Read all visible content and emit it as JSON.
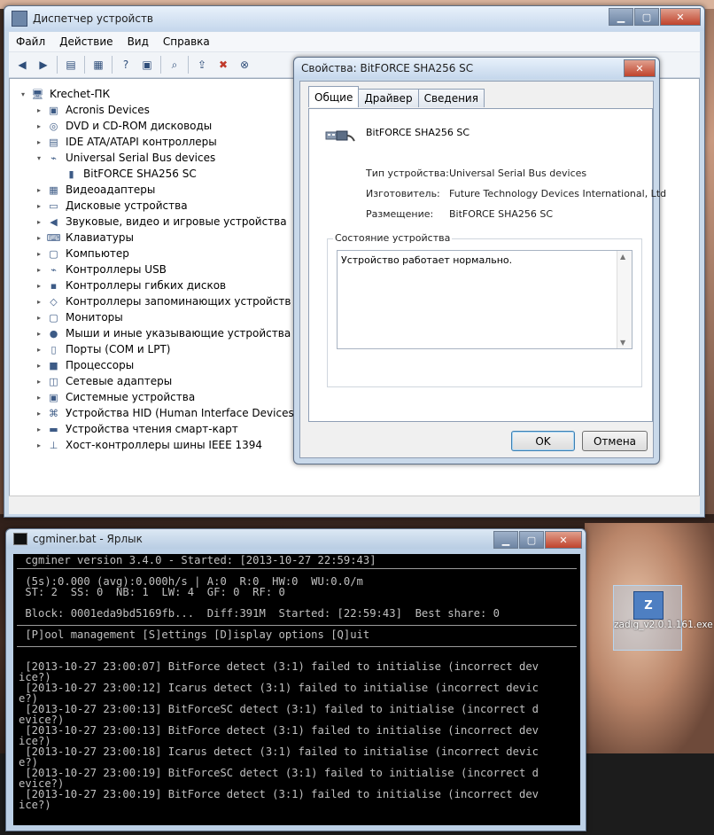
{
  "device_manager": {
    "title": "Диспетчер устройств",
    "menu": [
      "Файл",
      "Действие",
      "Вид",
      "Справка"
    ],
    "toolbar_icons": [
      "back-icon",
      "forward-icon",
      "up-icon",
      "properties-icon",
      "help-icon",
      "view-icon",
      "scan-icon",
      "update-driver-icon",
      "disable-icon",
      "uninstall-icon"
    ],
    "tree": [
      {
        "label": "Krechet-ПК",
        "level": 0,
        "expander": "▾",
        "icon": "computer-icon"
      },
      {
        "label": "Acronis Devices",
        "level": 1,
        "expander": "▸",
        "icon": "device-icon"
      },
      {
        "label": "DVD и CD-ROM дисководы",
        "level": 1,
        "expander": "▸",
        "icon": "dvd-icon"
      },
      {
        "label": "IDE ATA/ATAPI контроллеры",
        "level": 1,
        "expander": "▸",
        "icon": "ide-icon"
      },
      {
        "label": "Universal Serial Bus devices",
        "level": 1,
        "expander": "▾",
        "icon": "usb-icon"
      },
      {
        "label": "BitFORCE SHA256 SC",
        "level": 2,
        "expander": "",
        "icon": "usb-plug-icon"
      },
      {
        "label": "Видеоадаптеры",
        "level": 1,
        "expander": "▸",
        "icon": "display-adapter-icon"
      },
      {
        "label": "Дисковые устройства",
        "level": 1,
        "expander": "▸",
        "icon": "disk-icon"
      },
      {
        "label": "Звуковые, видео и игровые устройства",
        "level": 1,
        "expander": "▸",
        "icon": "speaker-icon"
      },
      {
        "label": "Клавиатуры",
        "level": 1,
        "expander": "▸",
        "icon": "keyboard-icon"
      },
      {
        "label": "Компьютер",
        "level": 1,
        "expander": "▸",
        "icon": "monitor-icon"
      },
      {
        "label": "Контроллеры USB",
        "level": 1,
        "expander": "▸",
        "icon": "usb-controller-icon"
      },
      {
        "label": "Контроллеры гибких дисков",
        "level": 1,
        "expander": "▸",
        "icon": "floppy-icon"
      },
      {
        "label": "Контроллеры запоминающих устройств",
        "level": 1,
        "expander": "▸",
        "icon": "storage-icon"
      },
      {
        "label": "Мониторы",
        "level": 1,
        "expander": "▸",
        "icon": "monitor-icon"
      },
      {
        "label": "Мыши и иные указывающие устройства",
        "level": 1,
        "expander": "▸",
        "icon": "mouse-icon"
      },
      {
        "label": "Порты (COM и LPT)",
        "level": 1,
        "expander": "▸",
        "icon": "port-icon"
      },
      {
        "label": "Процессоры",
        "level": 1,
        "expander": "▸",
        "icon": "cpu-icon"
      },
      {
        "label": "Сетевые адаптеры",
        "level": 1,
        "expander": "▸",
        "icon": "network-icon"
      },
      {
        "label": "Системные устройства",
        "level": 1,
        "expander": "▸",
        "icon": "system-icon"
      },
      {
        "label": "Устройства HID (Human Interface Devices)",
        "level": 1,
        "expander": "▸",
        "icon": "hid-icon"
      },
      {
        "label": "Устройства чтения смарт-карт",
        "level": 1,
        "expander": "▸",
        "icon": "smartcard-icon"
      },
      {
        "label": "Хост-контроллеры шины IEEE 1394",
        "level": 1,
        "expander": "▸",
        "icon": "firewire-icon"
      }
    ]
  },
  "properties_dialog": {
    "title": "Свойства: BitFORCE SHA256 SC",
    "tabs": [
      "Общие",
      "Драйвер",
      "Сведения"
    ],
    "device_name": "BitFORCE SHA256 SC",
    "properties": [
      {
        "label": "Тип устройства:",
        "value": "Universal Serial Bus devices"
      },
      {
        "label": "Изготовитель:",
        "value": "Future Technology Devices International, Ltd"
      },
      {
        "label": "Размещение:",
        "value": "BitFORCE SHA256 SC"
      }
    ],
    "status_group_title": "Состояние устройства",
    "status_text": "Устройство работает нормально.",
    "ok_label": "OK",
    "cancel_label": "Отмена"
  },
  "console": {
    "title": "cgminer.bat - Ярлык",
    "lines": [
      " cgminer version 3.4.0 - Started: [2013-10-27 22:59:43]",
      " (5s):0.000 (avg):0.000h/s | A:0  R:0  HW:0  WU:0.0/m",
      " ST: 2  SS: 0  NB: 1  LW: 4  GF: 0  RF: 0",
      " Block: 0001eda9bd5169fb...  Diff:391M  Started: [22:59:43]  Best share: 0",
      " [P]ool management [S]ettings [D]isplay options [Q]uit",
      " [2013-10-27 23:00:07] BitForce detect (3:1) failed to initialise (incorrect dev",
      "ice?)",
      " [2013-10-27 23:00:12] Icarus detect (3:1) failed to initialise (incorrect devic",
      "e?)",
      " [2013-10-27 23:00:13] BitForceSC detect (3:1) failed to initialise (incorrect d",
      "evice?)",
      " [2013-10-27 23:00:13] BitForce detect (3:1) failed to initialise (incorrect dev",
      "ice?)",
      " [2013-10-27 23:00:18] Icarus detect (3:1) failed to initialise (incorrect devic",
      "e?)",
      " [2013-10-27 23:00:19] BitForceSC detect (3:1) failed to initialise (incorrect d",
      "evice?)",
      " [2013-10-27 23:00:19] BitForce detect (3:1) failed to initialise (incorrect dev",
      "ice?)"
    ]
  },
  "desktop_icon": {
    "label": "zadig_v2.0.1.161.exe"
  },
  "colors": {
    "window_frame": "#c9d9ea",
    "console_bg": "#000000",
    "console_text": "#c0c0c0"
  }
}
